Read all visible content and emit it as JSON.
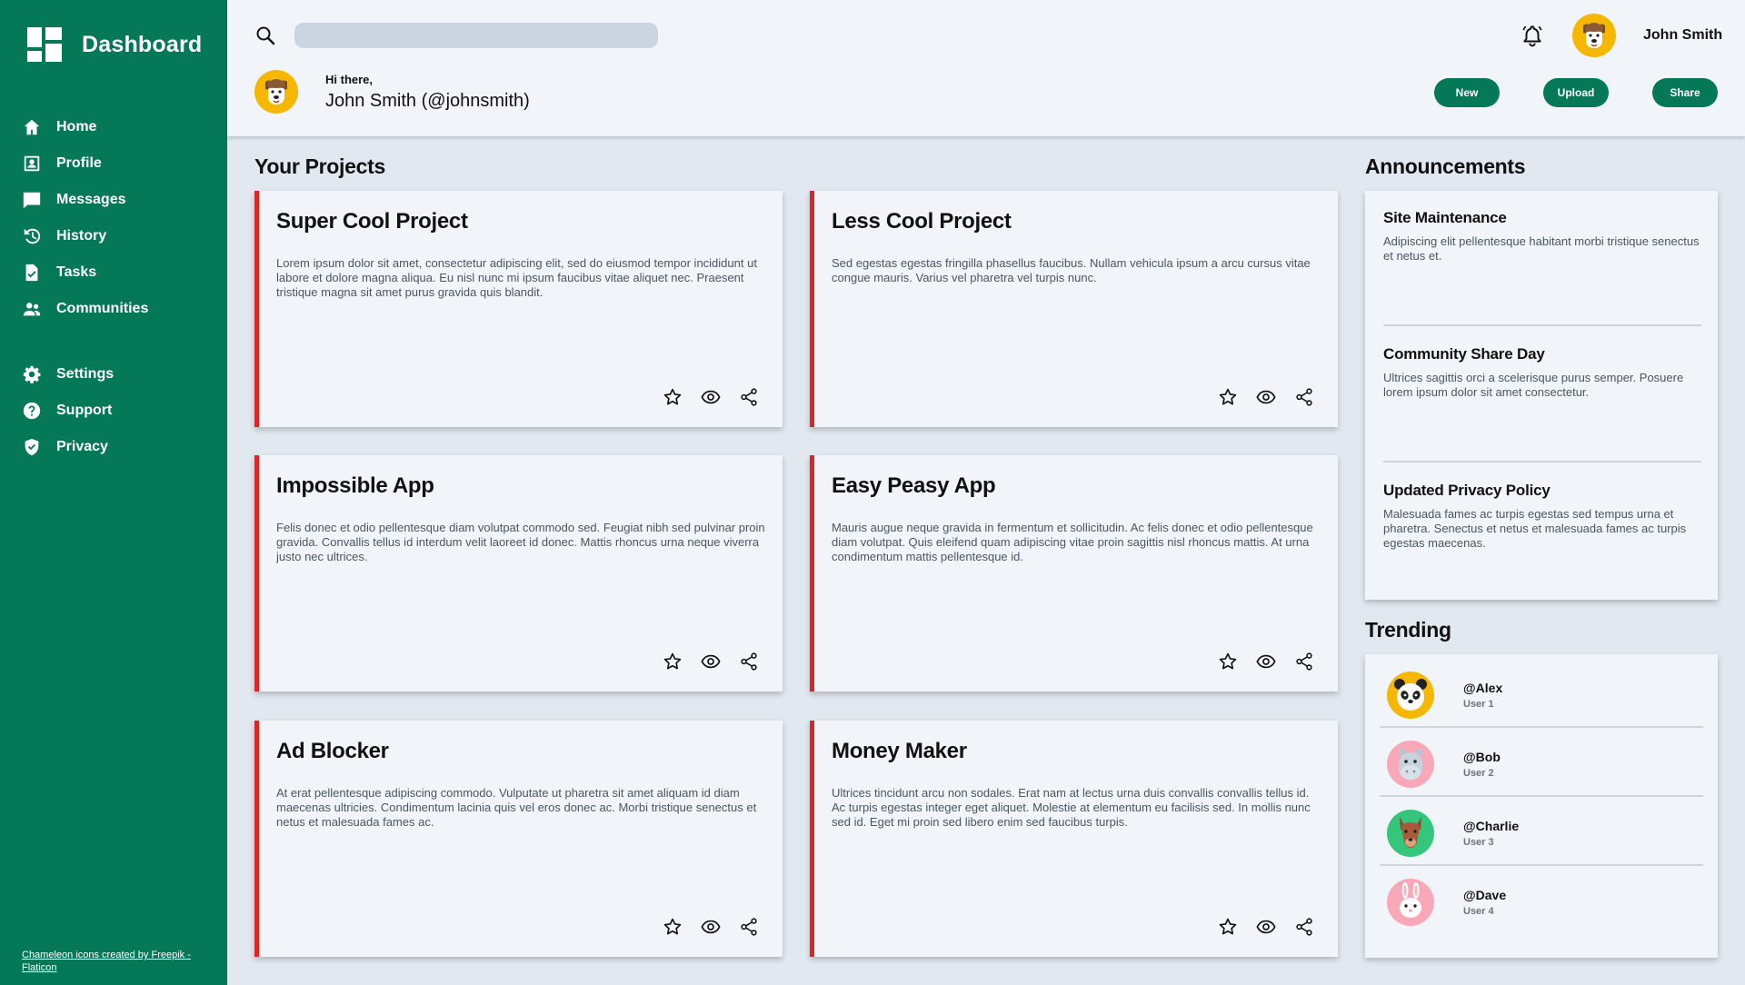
{
  "sidebar": {
    "brand": "Dashboard",
    "items": [
      {
        "label": "Home",
        "icon": "home-icon"
      },
      {
        "label": "Profile",
        "icon": "profile-icon"
      },
      {
        "label": "Messages",
        "icon": "messages-icon"
      },
      {
        "label": "History",
        "icon": "history-icon"
      },
      {
        "label": "Tasks",
        "icon": "tasks-icon"
      },
      {
        "label": "Communities",
        "icon": "communities-icon"
      }
    ],
    "secondary_items": [
      {
        "label": "Settings",
        "icon": "gear-icon"
      },
      {
        "label": "Support",
        "icon": "help-icon"
      },
      {
        "label": "Privacy",
        "icon": "shield-icon"
      }
    ],
    "credit": "Chameleon icons created by Freepik - Flaticon"
  },
  "header": {
    "search_value": "",
    "username": "John Smith",
    "greeting": "Hi there,",
    "full_name": "John Smith (@johnsmith)",
    "buttons": {
      "new": "New",
      "upload": "Upload",
      "share": "Share"
    }
  },
  "projects": {
    "title": "Your Projects",
    "items": [
      {
        "title": "Super Cool Project",
        "description": "Lorem ipsum dolor sit amet, consectetur adipiscing elit, sed do eiusmod tempor incididunt ut labore et dolore magna aliqua. Eu nisl nunc mi ipsum faucibus vitae aliquet nec. Praesent tristique magna sit amet purus gravida quis blandit."
      },
      {
        "title": "Less Cool Project",
        "description": "Sed egestas egestas fringilla phasellus faucibus. Nullam vehicula ipsum a arcu cursus vitae congue mauris. Varius vel pharetra vel turpis nunc."
      },
      {
        "title": "Impossible App",
        "description": "Felis donec et odio pellentesque diam volutpat commodo sed. Feugiat nibh sed pulvinar proin gravida. Convallis tellus id interdum velit laoreet id donec. Mattis rhoncus urna neque viverra justo nec ultrices."
      },
      {
        "title": "Easy Peasy App",
        "description": "Mauris augue neque gravida in fermentum et sollicitudin. Ac felis donec et odio pellentesque diam volutpat. Quis eleifend quam adipiscing vitae proin sagittis nisl rhoncus mattis. At urna condimentum mattis pellentesque id."
      },
      {
        "title": "Ad Blocker",
        "description": "At erat pellentesque adipiscing commodo. Vulputate ut pharetra sit amet aliquam id diam maecenas ultricies. Condimentum lacinia quis vel eros donec ac. Morbi tristique senectus et netus et malesuada fames ac."
      },
      {
        "title": "Money Maker",
        "description": "Ultrices tincidunt arcu non sodales. Erat nam at lectus urna duis convallis convallis tellus id. Ac turpis egestas integer eget aliquet. Molestie at elementum eu facilisis sed. In mollis nunc sed id. Eget mi proin sed libero enim sed faucibus turpis."
      }
    ]
  },
  "announcements": {
    "title": "Announcements",
    "items": [
      {
        "title": "Site Maintenance",
        "description": "Adipiscing elit pellentesque habitant morbi tristique senectus et netus et."
      },
      {
        "title": "Community Share Day",
        "description": "Ultrices sagittis orci a scelerisque purus semper. Posuere lorem ipsum dolor sit amet consectetur."
      },
      {
        "title": "Updated Privacy Policy",
        "description": "Malesuada fames ac turpis egestas sed tempus urna et pharetra. Senectus et netus et malesuada fames ac turpis egestas maecenas."
      }
    ]
  },
  "trending": {
    "title": "Trending",
    "items": [
      {
        "handle": "@Alex",
        "subtitle": "User 1",
        "avatar": "panda-avatar"
      },
      {
        "handle": "@Bob",
        "subtitle": "User 2",
        "avatar": "hippo-avatar"
      },
      {
        "handle": "@Charlie",
        "subtitle": "User 3",
        "avatar": "kangaroo-avatar"
      },
      {
        "handle": "@Dave",
        "subtitle": "User 4",
        "avatar": "rabbit-avatar"
      }
    ]
  },
  "colors": {
    "sidebar": "#047857",
    "accent_button": "#047857",
    "card_accent": "#dc2626",
    "background": "#e2e8f0",
    "card_bg": "#f1f5f9"
  }
}
